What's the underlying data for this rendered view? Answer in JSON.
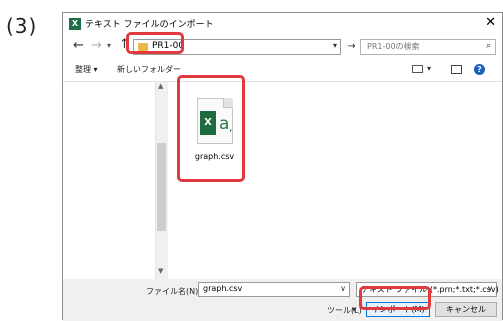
{
  "step_label": "(3)",
  "window": {
    "title": "テキスト ファイルのインポート",
    "close": "✕",
    "app_icon": "X"
  },
  "nav": {
    "back": "←",
    "forward": "→",
    "dropdown": "▾",
    "up": "↑",
    "address": "PR1-00",
    "address_dropdown": "▾",
    "go": "→",
    "search_placeholder": "PR1-00の検索",
    "search_icon": "⌕"
  },
  "toolbar": {
    "organize": "整理 ▾",
    "new_folder": "新しいフォルダー",
    "view_dropdown": "▾",
    "help": "?"
  },
  "files": [
    {
      "name": "graph.csv",
      "icon": "excel-csv-file-icon"
    }
  ],
  "file_icon": {
    "badge": "X",
    "glyph": "a",
    "comma": ","
  },
  "scrollbar": {
    "up": "▲",
    "down": "▼"
  },
  "bottom": {
    "filename_label": "ファイル名(N):",
    "filename_value": "graph.csv",
    "filename_dropdown": "∨",
    "filetype_value": "テキスト ファイル (*.prn;*.txt;*.csv)",
    "filetype_dropdown": "∨",
    "tools_label": "ツール(L)",
    "tools_dropdown": "▾",
    "import_button": "インポート(M)",
    "cancel_button": "キャンセル"
  },
  "colors": {
    "highlight": "#e03a3e",
    "accent": "#0078d7",
    "excel_green": "#1d6b3f"
  }
}
